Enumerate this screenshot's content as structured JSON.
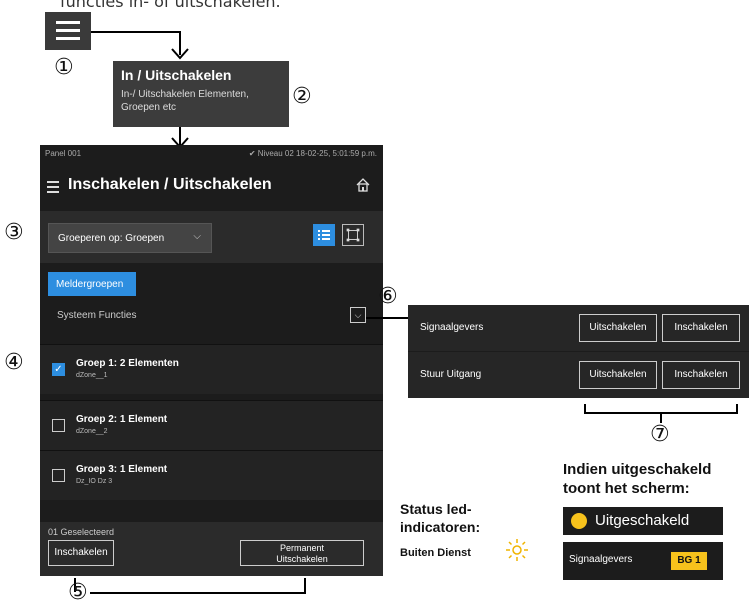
{
  "intro_text": "functies in- of uitschakelen.",
  "callouts": {
    "c1": "①",
    "c2": "②",
    "c3": "③",
    "c4": "④",
    "c5": "⑤",
    "c6": "⑥",
    "c7": "⑦"
  },
  "tooltip": {
    "title": "In / Uitschakelen",
    "subtitle": "In-/ Uitschakelen Elementen, Groepen etc"
  },
  "panel": {
    "status_left": "Panel 001",
    "status_right": "✔ Niveau 02  18-02-25, 5:01:59 p.m.",
    "title": "Inschakelen / Uitschakelen",
    "group_select": "Groeperen op: Groepen",
    "tab_label": "Meldergroepen",
    "section_label": "Systeem Functies",
    "rows": [
      {
        "title": "Groep 1: 2 Elementen",
        "sub": "dZone__1",
        "checked": true
      },
      {
        "title": "Groep 2: 1 Element",
        "sub": "dZone__2",
        "checked": false
      },
      {
        "title": "Groep 3: 1 Element",
        "sub": "Dz_IO Dz 3",
        "checked": false
      }
    ],
    "selected_count": "01 Geselecteerd",
    "btn_enable": "Inschakelen",
    "btn_perm_line1": "Permanent",
    "btn_perm_line2": "Uitschakelen"
  },
  "zoom_panel": {
    "rows": [
      {
        "label": "Signaalgevers",
        "btn_disable": "Uitschakelen",
        "btn_enable": "Inschakelen"
      },
      {
        "label": "Stuur Uitgang",
        "btn_disable": "Uitschakelen",
        "btn_enable": "Inschakelen"
      }
    ]
  },
  "legend": {
    "indien_line1": "Indien uitgeschakeld",
    "indien_line2": "toont het scherm:",
    "badge_uit": "Uitgeschakeld",
    "badge_sig": "Signaalgevers",
    "badge_bg": "BG 1",
    "status_line1": "Status led-",
    "status_line2": "indicatoren:",
    "buiten_dienst": "Buiten Dienst"
  },
  "colors": {
    "accent_blue": "#2d8ee0",
    "warning_yellow": "#f7c21c",
    "panel_bg": "#1c1c1c"
  }
}
